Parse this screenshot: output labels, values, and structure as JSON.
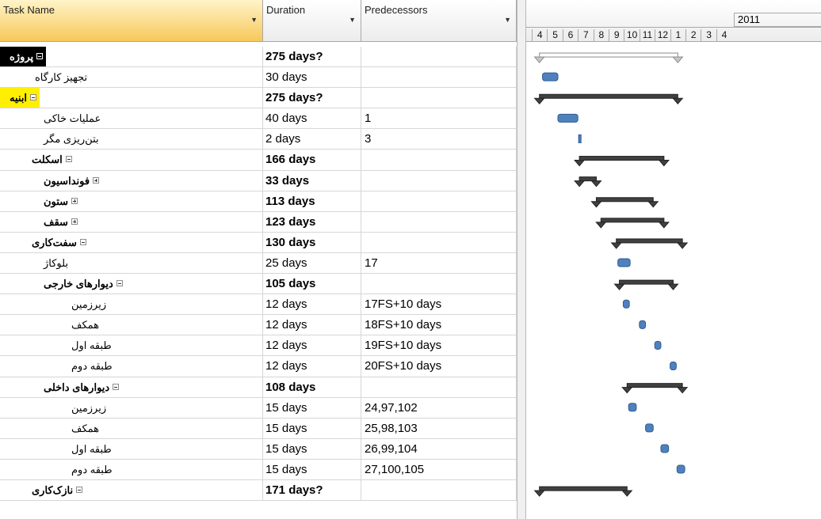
{
  "columns": {
    "task_name": "Task Name",
    "duration": "Duration",
    "predecessors": "Predecessors"
  },
  "timescale": {
    "year": "2011",
    "months": [
      "4",
      "5",
      "6",
      "7",
      "8",
      "9",
      "10",
      "11",
      "12",
      "1",
      "2",
      "3",
      "4"
    ]
  },
  "tasks": [
    {
      "name": "پروژه",
      "duration": "275 days?",
      "predecessors": "",
      "level": 0,
      "summary": true,
      "state": "selected",
      "toggle": "minus",
      "start": 0.5,
      "finish": 9.5
    },
    {
      "name": "تجهیز کارگاه",
      "duration": "30 days",
      "predecessors": "",
      "level": 1,
      "summary": false,
      "start": 0.7,
      "finish": 1.7
    },
    {
      "name": "ابنیه",
      "duration": "275 days?",
      "predecessors": "",
      "level": 1,
      "summary": true,
      "state": "highlighted",
      "toggle": "minus",
      "start": 0.5,
      "finish": 9.5
    },
    {
      "name": "عملیات خاکی",
      "duration": "40 days",
      "predecessors": "1",
      "level": 2,
      "summary": false,
      "start": 1.7,
      "finish": 3.0
    },
    {
      "name": "بتن‌ریزی مگر",
      "duration": "2 days",
      "predecessors": "3",
      "level": 2,
      "summary": false,
      "start": 3.05,
      "finish": 3.12
    },
    {
      "name": "اسکلت",
      "duration": "166 days",
      "predecessors": "",
      "level": 2,
      "summary": true,
      "toggle": "minus",
      "start": 3.1,
      "finish": 8.6
    },
    {
      "name": "فونداسیون",
      "duration": "33 days",
      "predecessors": "",
      "level": 3,
      "summary": true,
      "toggle": "plus",
      "start": 3.1,
      "finish": 4.2
    },
    {
      "name": "ستون",
      "duration": "113 days",
      "predecessors": "",
      "level": 3,
      "summary": true,
      "toggle": "plus",
      "start": 4.2,
      "finish": 7.9
    },
    {
      "name": "سقف",
      "duration": "123 days",
      "predecessors": "",
      "level": 3,
      "summary": true,
      "toggle": "plus",
      "start": 4.5,
      "finish": 8.6
    },
    {
      "name": "سفت‌کاری",
      "duration": "130 days",
      "predecessors": "",
      "level": 2,
      "summary": true,
      "toggle": "minus",
      "start": 5.5,
      "finish": 9.8
    },
    {
      "name": "بلوکاژ",
      "duration": "25 days",
      "predecessors": "17",
      "level": 3,
      "summary": false,
      "start": 5.6,
      "finish": 6.4
    },
    {
      "name": "دیوارهای خارجی",
      "duration": "105 days",
      "predecessors": "",
      "level": 3,
      "summary": true,
      "toggle": "minus",
      "start": 5.7,
      "finish": 9.2
    },
    {
      "name": "زیرزمین",
      "duration": "12 days",
      "predecessors": "17FS+10 days",
      "level": 4,
      "summary": false,
      "start": 5.95,
      "finish": 6.35
    },
    {
      "name": "همکف",
      "duration": "12 days",
      "predecessors": "18FS+10 days",
      "level": 4,
      "summary": false,
      "start": 7.0,
      "finish": 7.4
    },
    {
      "name": "طبقه اول",
      "duration": "12 days",
      "predecessors": "19FS+10 days",
      "level": 4,
      "summary": false,
      "start": 8.0,
      "finish": 8.4
    },
    {
      "name": "طبقه دوم",
      "duration": "12 days",
      "predecessors": "20FS+10 days",
      "level": 4,
      "summary": false,
      "start": 9.0,
      "finish": 9.4
    },
    {
      "name": "دیوارهای داخلی",
      "duration": "108 days",
      "predecessors": "",
      "level": 3,
      "summary": true,
      "toggle": "minus",
      "start": 6.2,
      "finish": 9.8
    },
    {
      "name": "زیرزمین",
      "duration": "15 days",
      "predecessors": "24,97,102",
      "level": 4,
      "summary": false,
      "start": 6.3,
      "finish": 6.8
    },
    {
      "name": "همکف",
      "duration": "15 days",
      "predecessors": "25,98,103",
      "level": 4,
      "summary": false,
      "start": 7.4,
      "finish": 7.9
    },
    {
      "name": "طبقه اول",
      "duration": "15 days",
      "predecessors": "26,99,104",
      "level": 4,
      "summary": false,
      "start": 8.4,
      "finish": 8.9
    },
    {
      "name": "طبقه دوم",
      "duration": "15 days",
      "predecessors": "27,100,105",
      "level": 4,
      "summary": false,
      "start": 9.45,
      "finish": 9.95
    },
    {
      "name": "نازک‌کاری",
      "duration": "171 days?",
      "predecessors": "",
      "level": 2,
      "summary": true,
      "toggle": "minus",
      "start": 0.5,
      "finish": 6.2
    }
  ],
  "colors": {
    "selected_bg": "#000000",
    "highlight_bg": "#ffef00",
    "task_bar": "#4f81bd",
    "summary_bar": "#404040"
  }
}
